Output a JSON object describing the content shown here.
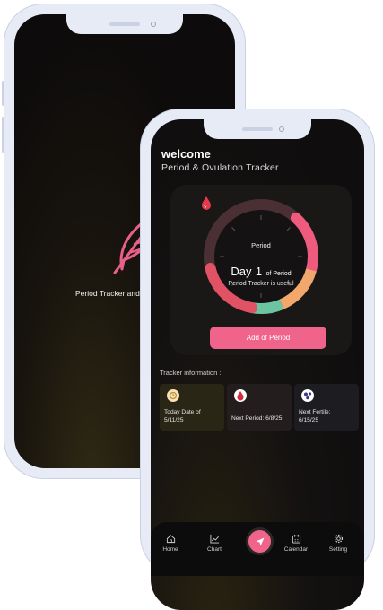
{
  "splash": {
    "text": "Period Tracker and",
    "icon": "feather-icon"
  },
  "home": {
    "welcome": "welcome",
    "subtitle": "Period & Ovulation Tracker",
    "period_label": "Period",
    "day_prefix": "Day",
    "day_number": "1",
    "day_suffix": "of Period",
    "tracker_useful": "Period Tracker is useful",
    "add_button": "Add of Period",
    "tracker_info_label": "Tracker information :",
    "cards": [
      {
        "icon": "calendar-clock-icon",
        "line1": "Today Date of",
        "line2": "5/11/25"
      },
      {
        "icon": "blood-drop-icon",
        "line1": "Next Period: 6/8/25",
        "line2": ""
      },
      {
        "icon": "ovum-icon",
        "line1": "Next Fertile:",
        "line2": "6/15/25"
      }
    ]
  },
  "nav": {
    "home": "Home",
    "chart": "Chart",
    "calendar": "Calendar",
    "setting": "Setting"
  },
  "colors": {
    "accent": "#f0648c",
    "ring_pink": "#ee5b7e",
    "ring_orange": "#f2a86d",
    "ring_green": "#6bc5a0",
    "ring_red": "#e05264",
    "ring_track": "#4a3034"
  }
}
